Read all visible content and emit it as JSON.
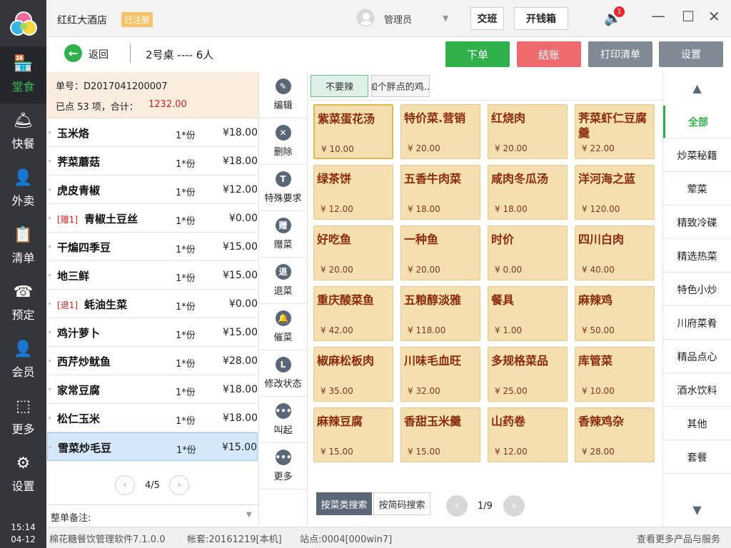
{
  "header": {
    "hotel_name": "红红大酒店",
    "registered_badge": "已注册",
    "user_role": "管理员",
    "shift_button": "交班",
    "cashbox_button": "开钱箱",
    "notification_count": "1"
  },
  "nav": {
    "items": [
      {
        "label": "堂食",
        "icon": "storefront-icon",
        "glyph": "🏪"
      },
      {
        "label": "快餐",
        "icon": "cloche-icon",
        "glyph": "🛎"
      },
      {
        "label": "外卖",
        "icon": "delivery-person-icon",
        "glyph": "👤"
      },
      {
        "label": "清单",
        "icon": "clipboard-icon",
        "glyph": "📋"
      },
      {
        "label": "预定",
        "icon": "phone-icon",
        "glyph": "☎"
      },
      {
        "label": "会员",
        "icon": "member-icon",
        "glyph": "👤"
      },
      {
        "label": "更多",
        "icon": "grid-icon",
        "glyph": "⬚"
      },
      {
        "label": "设置",
        "icon": "gear-icon",
        "glyph": "⚙"
      }
    ],
    "time": "15:14",
    "date": "04-12"
  },
  "toolbar": {
    "back_label": "返回",
    "table_info": "2号桌 ---- 6人",
    "order_button": "下单",
    "checkout_button": "结账",
    "print_button": "打印清单",
    "settings_button": "设置"
  },
  "order": {
    "number_text": "单号：D2017041200007",
    "summary_text": "已点 53 项，合计：",
    "total": "1232.00",
    "items": [
      {
        "tag": "",
        "name": "玉米烙",
        "qty": "1*份",
        "price": "¥18.00"
      },
      {
        "tag": "",
        "name": "荠菜蘑菇",
        "qty": "1*份",
        "price": "¥18.00"
      },
      {
        "tag": "",
        "name": "虎皮青椒",
        "qty": "1*份",
        "price": "¥12.00"
      },
      {
        "tag": "[赠1]",
        "name": "青椒土豆丝",
        "qty": "1*份",
        "price": "¥0.00"
      },
      {
        "tag": "",
        "name": "干煸四季豆",
        "qty": "1*份",
        "price": "¥15.00"
      },
      {
        "tag": "",
        "name": "地三鲜",
        "qty": "1*份",
        "price": "¥15.00"
      },
      {
        "tag": "[退1]",
        "name": "蚝油生菜",
        "qty": "1*份",
        "price": "¥0.00"
      },
      {
        "tag": "",
        "name": "鸡汁萝卜",
        "qty": "1*份",
        "price": "¥15.00"
      },
      {
        "tag": "",
        "name": "西芹炒鱿鱼",
        "qty": "1*份",
        "price": "¥28.00"
      },
      {
        "tag": "",
        "name": "家常豆腐",
        "qty": "1*份",
        "price": "¥18.00"
      },
      {
        "tag": "",
        "name": "松仁玉米",
        "qty": "1*份",
        "price": "¥18.00"
      },
      {
        "tag": "",
        "name": "雪菜炒毛豆",
        "qty": "1*份",
        "price": "¥15.00"
      }
    ],
    "page": "4/5",
    "remark_label": "整单备注:"
  },
  "actions": [
    {
      "label": "编辑",
      "glyph": "✎",
      "icon": "edit-icon"
    },
    {
      "label": "删除",
      "glyph": "✕",
      "icon": "delete-icon"
    },
    {
      "label": "特殊要求",
      "glyph": "T",
      "icon": "special-request-icon"
    },
    {
      "label": "赠菜",
      "glyph": "赠",
      "icon": "gift-dish-icon"
    },
    {
      "label": "退菜",
      "glyph": "退",
      "icon": "return-dish-icon"
    },
    {
      "label": "催菜",
      "glyph": "🔔",
      "icon": "hurry-bell-icon"
    },
    {
      "label": "修改状态",
      "glyph": "L",
      "icon": "change-status-icon"
    },
    {
      "label": "叫起",
      "glyph": "•••",
      "icon": "call-up-icon"
    },
    {
      "label": "更多",
      "glyph": "•••",
      "icon": "more-icon"
    }
  ],
  "tags": [
    "不要辣",
    "加个胖点的鸡..."
  ],
  "dishes": [
    {
      "name": "紫菜蛋花汤",
      "price": "¥ 10.00"
    },
    {
      "name": "特价菜.营销",
      "price": "¥ 20.00"
    },
    {
      "name": "红烧肉",
      "price": "¥ 20.00"
    },
    {
      "name": "荠菜虾仁豆腐羹",
      "price": "¥ 22.00"
    },
    {
      "name": "绿茶饼",
      "price": "¥ 12.00"
    },
    {
      "name": "五香牛肉菜",
      "price": "¥ 18.00"
    },
    {
      "name": "咸肉冬瓜汤",
      "price": "¥ 18.00"
    },
    {
      "name": "洋河海之蓝",
      "price": "¥ 120.00"
    },
    {
      "name": "好吃鱼",
      "price": "¥ 20.00"
    },
    {
      "name": "一种鱼",
      "price": "¥ 20.00"
    },
    {
      "name": "时价",
      "price": "¥ 0.00"
    },
    {
      "name": "四川白肉",
      "price": "¥ 40.00"
    },
    {
      "name": "重庆酸菜鱼",
      "price": "¥ 42.00"
    },
    {
      "name": "五粮醇淡雅",
      "price": "¥ 118.00"
    },
    {
      "name": "餐具",
      "price": "¥ 1.00"
    },
    {
      "name": "麻辣鸡",
      "price": "¥ 50.00"
    },
    {
      "name": "椒麻松板肉",
      "price": "¥ 35.00"
    },
    {
      "name": "川味毛血旺",
      "price": "¥ 32.00"
    },
    {
      "name": "多规格菜品",
      "price": "¥ 25.00"
    },
    {
      "name": "库管菜",
      "price": "¥ 10.00"
    },
    {
      "name": "麻辣豆腐",
      "price": "¥ 15.00"
    },
    {
      "name": "香甜玉米羹",
      "price": "¥ 15.00"
    },
    {
      "name": "山药卷",
      "price": "¥ 12.00"
    },
    {
      "name": "香辣鸡杂",
      "price": "¥ 28.00"
    }
  ],
  "search": {
    "by_category": "按菜类搜索",
    "by_code": "按简码搜索",
    "page": "1/9"
  },
  "categories": [
    "全部",
    "炒菜秘籍",
    "荤菜",
    "精致冷碟",
    "精选热菜",
    "特色小炒",
    "川府菜肴",
    "精品点心",
    "酒水饮料",
    "其他",
    "套餐"
  ],
  "footer": {
    "software": "棉花糖餐饮管理软件7.1.0.0",
    "account": "帐套:20161219[本机]",
    "station": "站点:0004[000win7]",
    "more_link": "查看更多产品与服务"
  },
  "colors": {
    "accent_green": "#2fb04a",
    "checkout_red": "#ee6a6e",
    "nav_dark": "#33363b",
    "dish_bg": "#f6dfae",
    "dish_text": "#8a2b0c"
  }
}
